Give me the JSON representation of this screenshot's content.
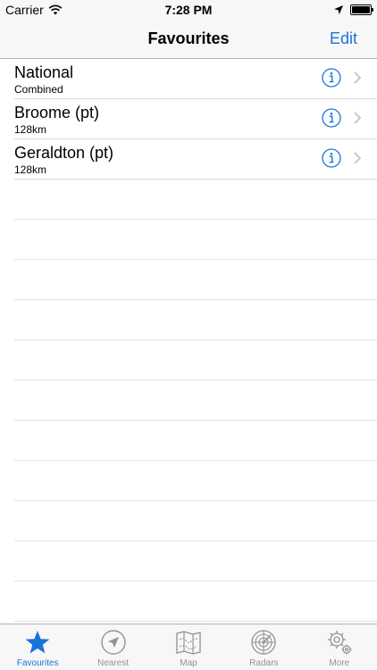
{
  "status_bar": {
    "carrier": "Carrier",
    "time": "7:28 PM"
  },
  "nav": {
    "title": "Favourites",
    "edit_label": "Edit"
  },
  "favourites": [
    {
      "title": "National",
      "subtitle": "Combined"
    },
    {
      "title": "Broome (pt)",
      "subtitle": "128km"
    },
    {
      "title": "Geraldton (pt)",
      "subtitle": "128km"
    }
  ],
  "tabs": [
    {
      "label": "Favourites",
      "icon": "star-icon",
      "active": true
    },
    {
      "label": "Nearest",
      "icon": "location-arrow-icon",
      "active": false
    },
    {
      "label": "Map",
      "icon": "map-icon",
      "active": false
    },
    {
      "label": "Radars",
      "icon": "radar-icon",
      "active": false
    },
    {
      "label": "More",
      "icon": "gear-icon",
      "active": false
    }
  ],
  "colors": {
    "accent": "#1a73d9",
    "inactive": "#929292",
    "bar_bg": "#f7f7f7"
  }
}
